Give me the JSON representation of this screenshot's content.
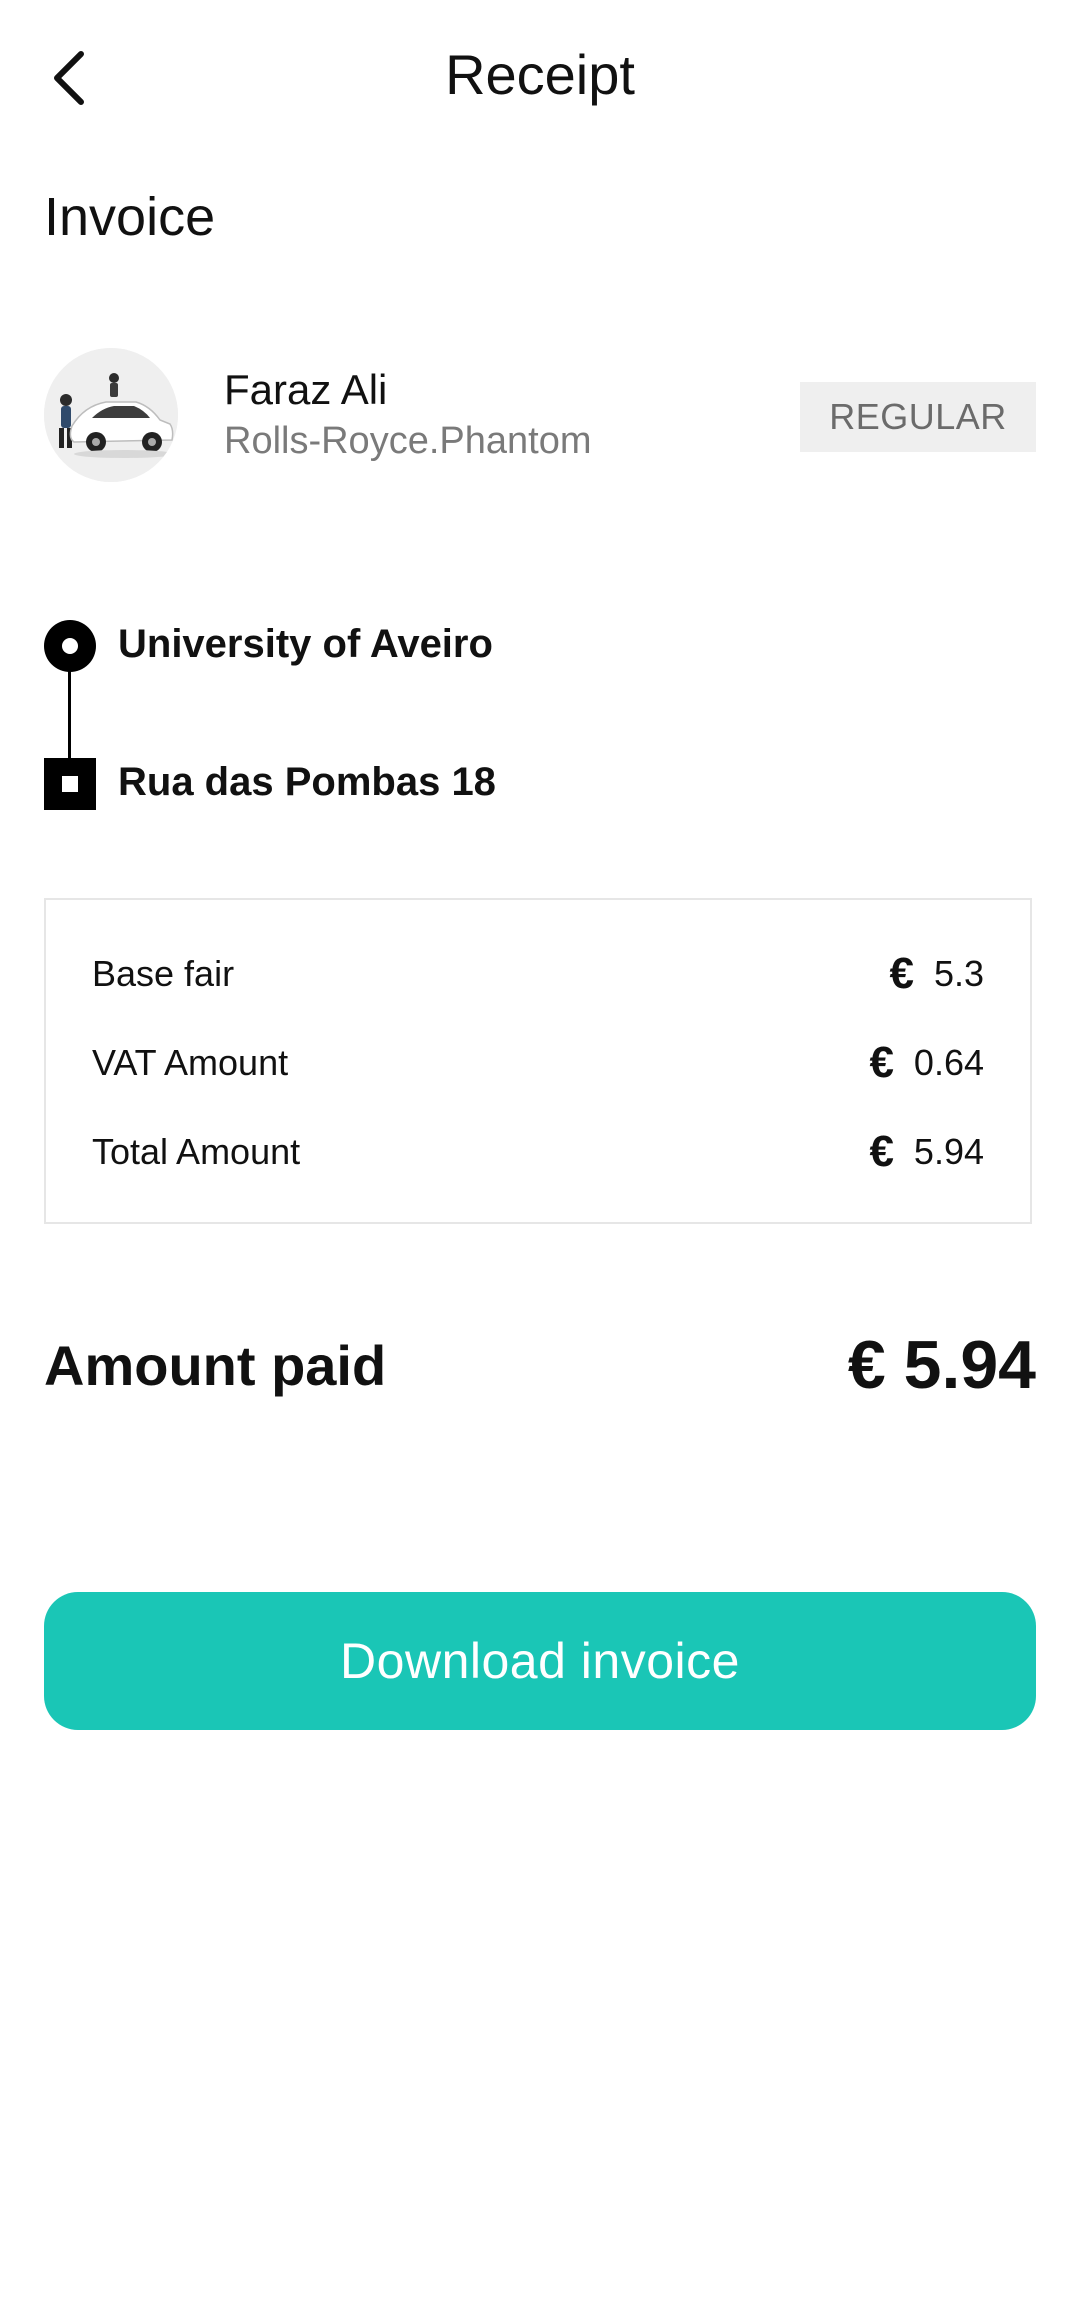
{
  "header": {
    "title": "Receipt",
    "back_icon": "chevron-left-icon"
  },
  "invoice": {
    "section_title": "Invoice"
  },
  "driver": {
    "name": "Faraz Ali",
    "car": "Rolls-Royce.Phantom",
    "ride_type": "REGULAR",
    "avatar_icon": "car-avatar-icon"
  },
  "route": {
    "pickup": "University of Aveiro",
    "dropoff": "Rua das Pombas 18",
    "pickup_icon": "pickup-circle-icon",
    "dropoff_icon": "dropoff-square-icon"
  },
  "fare": {
    "rows": [
      {
        "label": "Base fair",
        "currency": "€",
        "value": "5.3"
      },
      {
        "label": "VAT Amount",
        "currency": "€",
        "value": "0.64"
      },
      {
        "label": "Total Amount",
        "currency": "€",
        "value": "5.94"
      }
    ]
  },
  "payment": {
    "label": "Amount paid",
    "currency": "€",
    "value": "5.94"
  },
  "actions": {
    "download_label": "Download invoice"
  },
  "colors": {
    "accent": "#1ac6b6",
    "badge_bg": "#efefef",
    "text_primary": "#111111",
    "text_secondary": "#7a7a7a"
  }
}
